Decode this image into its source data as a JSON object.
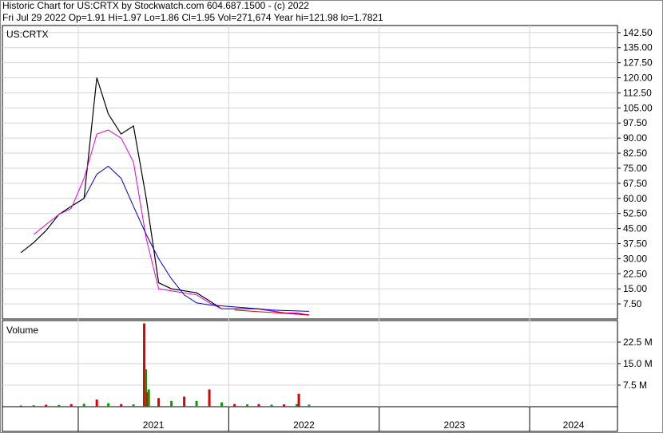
{
  "header": {
    "line1": "Historic Chart for US:CRTX by Stockwatch.com 604.687.1500 - (c) 2022",
    "line2": "Fri Jul 29 2022   Op=1.91   Hi=1.97   Lo=1.86   Cl=1.95   Vol=271,674   Year hi=121.98   lo=1.7821"
  },
  "chart_data": [
    {
      "type": "line",
      "title": "US:CRTX",
      "xlabel": "",
      "ylabel": "",
      "ylim": [
        0,
        146
      ],
      "y_ticks": [
        "142.50",
        "135.00",
        "127.50",
        "120.00",
        "112.50",
        "105.00",
        "97.50",
        "90.00",
        "82.50",
        "75.00",
        "67.50",
        "60.00",
        "52.50",
        "45.00",
        "37.50",
        "30.00",
        "22.50",
        "15.00",
        "7.50"
      ],
      "x_ticks": [
        "2021",
        "2022",
        "2023",
        "2024"
      ],
      "grid": true,
      "series": [
        {
          "color": "#000000",
          "x": [
            "2020-08",
            "2020-09",
            "2020-10",
            "2020-11",
            "2020-12",
            "2021-01",
            "2021-02",
            "2021-03",
            "2021-04",
            "2021-05",
            "2021-06",
            "2021-07",
            "2021-08",
            "2021-09",
            "2021-10",
            "2021-11",
            "2021-12",
            "2022-01",
            "2022-02",
            "2022-03",
            "2022-04",
            "2022-05",
            "2022-06",
            "2022-07"
          ],
          "values": [
            33,
            38,
            44,
            52,
            56,
            60,
            120,
            102,
            92,
            96,
            60,
            18,
            15,
            14,
            13,
            9,
            5,
            5,
            5,
            5,
            4,
            3,
            2.5,
            2
          ]
        },
        {
          "color": "#e000e0",
          "x": [
            "2020-09",
            "2020-10",
            "2020-11",
            "2020-12",
            "2021-01",
            "2021-02",
            "2021-03",
            "2021-04",
            "2021-05",
            "2021-06",
            "2021-07",
            "2021-08",
            "2021-09",
            "2021-10",
            "2021-11",
            "2021-12",
            "2022-01",
            "2022-02",
            "2022-03",
            "2022-04",
            "2022-05",
            "2022-06",
            "2022-07"
          ],
          "values": [
            42,
            47,
            52,
            55,
            70,
            92,
            94,
            90,
            78,
            40,
            15,
            14,
            13,
            12,
            8,
            5,
            5,
            5,
            5,
            4,
            3,
            3,
            2
          ]
        },
        {
          "color": "#0000c0",
          "x": [
            "2021-01",
            "2021-02",
            "2021-03",
            "2021-04",
            "2021-05",
            "2021-06",
            "2021-07",
            "2021-08",
            "2021-09",
            "2021-10",
            "2021-11",
            "2021-12",
            "2022-01",
            "2022-02",
            "2022-03",
            "2022-04",
            "2022-05",
            "2022-06",
            "2022-07"
          ],
          "values": [
            60,
            72,
            76,
            70,
            56,
            42,
            30,
            20,
            12,
            8,
            7,
            6.5,
            6,
            5.5,
            5,
            4.5,
            4.2,
            4,
            3.8
          ]
        },
        {
          "color": "#e00000",
          "x": [
            "2022-01",
            "2022-02",
            "2022-03",
            "2022-04",
            "2022-05",
            "2022-06",
            "2022-07"
          ],
          "values": [
            4.5,
            4.0,
            3.6,
            3.2,
            2.8,
            2.4,
            2.0
          ]
        }
      ]
    },
    {
      "type": "bar",
      "title": "Volume",
      "xlabel": "",
      "ylabel": "",
      "ylim": [
        0,
        30000000
      ],
      "y_ticks": [
        "22.5 M",
        "15.0 M",
        "7.5 M"
      ],
      "grid": true,
      "x": [
        "2020-08",
        "2020-09",
        "2020-10",
        "2020-11",
        "2020-12",
        "2021-01",
        "2021-02",
        "2021-03",
        "2021-04",
        "2021-05",
        "2021-06-10",
        "2021-06-14",
        "2021-06-17",
        "2021-06-21",
        "2021-07",
        "2021-08",
        "2021-09",
        "2021-10",
        "2021-11",
        "2021-12",
        "2022-01",
        "2022-02",
        "2022-03",
        "2022-04",
        "2022-05",
        "2022-06",
        "2022-06-20",
        "2022-07"
      ],
      "values": [
        400000,
        500000,
        700000,
        600000,
        900000,
        1000000,
        2500000,
        1200000,
        900000,
        800000,
        29000000,
        13000000,
        5000000,
        6000000,
        3000000,
        2000000,
        3500000,
        2000000,
        6000000,
        1500000,
        900000,
        800000,
        900000,
        700000,
        800000,
        900000,
        4500000,
        700000
      ]
    }
  ]
}
